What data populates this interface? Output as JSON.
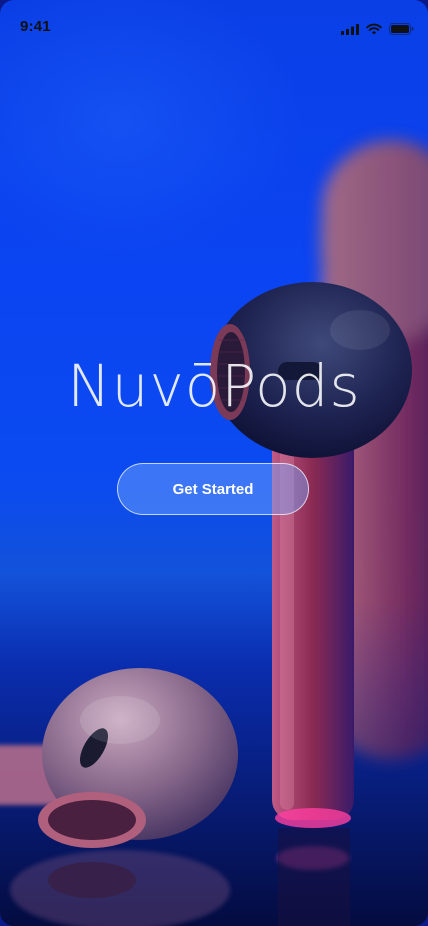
{
  "status_bar": {
    "time": "9:41",
    "icons": [
      "signal-icon",
      "wifi-icon",
      "battery-icon"
    ]
  },
  "hero": {
    "brand_name": "NuvōPods",
    "cta_label": "Get Started"
  },
  "colors": {
    "background_top": "#0a3fe6",
    "background_bottom": "#07155f",
    "earbud_body": "#8a2a4a",
    "cta_fill": "#78aaff"
  }
}
